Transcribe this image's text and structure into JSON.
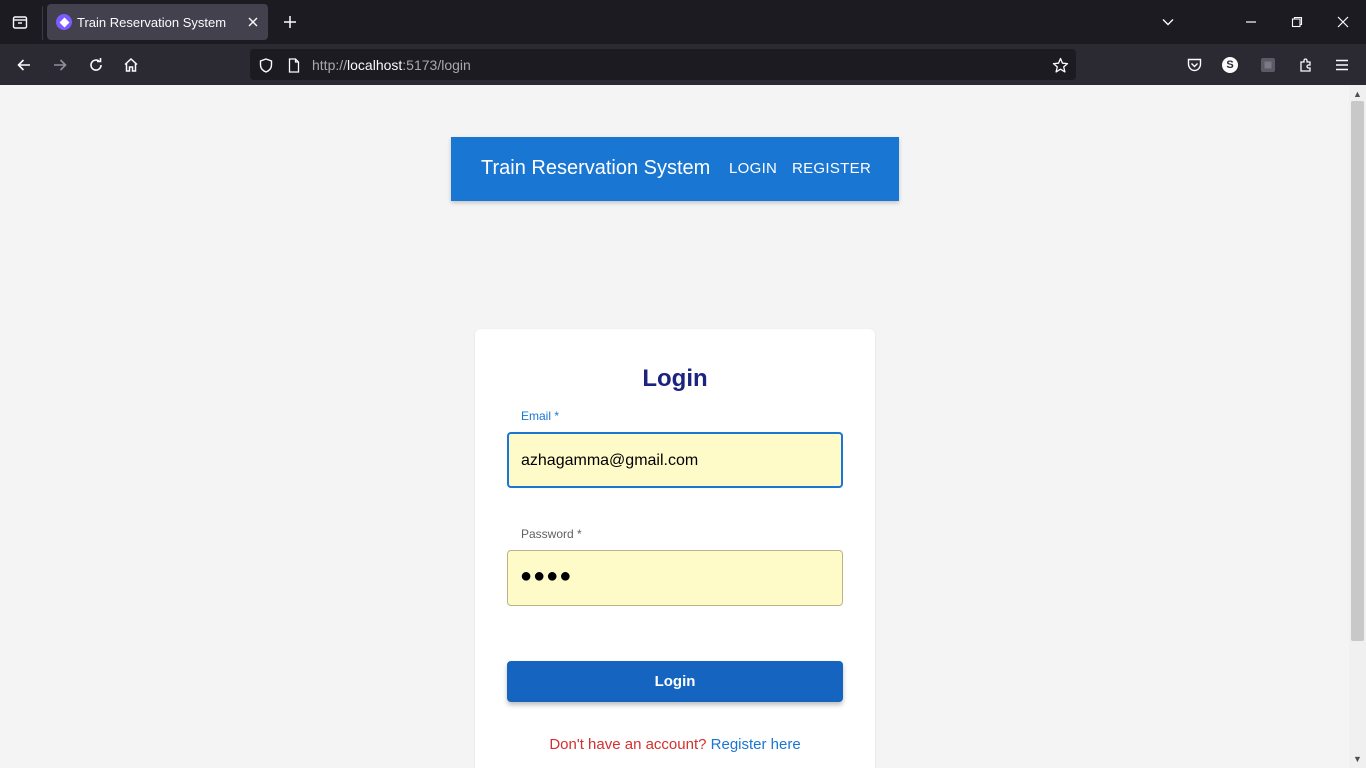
{
  "browser": {
    "tab_title": "Train Reservation System",
    "url_prefix": "http://",
    "url_host": "localhost",
    "url_rest": ":5173/login",
    "profile_initial": "S"
  },
  "app": {
    "title": "Train Reservation System",
    "nav": {
      "login": "LOGIN",
      "register": "REGISTER"
    },
    "colors": {
      "appbar": "#1976d2",
      "heading": "#1a237e",
      "button": "#1565c0",
      "prompt": "#d32f2f",
      "link": "#1976d2",
      "field_bg": "#fffbc8"
    }
  },
  "form": {
    "heading": "Login",
    "email_label": "Email *",
    "email_value": "azhagamma@gmail.com",
    "password_label": "Password *",
    "password_mask": "●●●●",
    "submit_label": "Login",
    "register_prompt": "Don't have an account?",
    "register_link": "Register here"
  }
}
